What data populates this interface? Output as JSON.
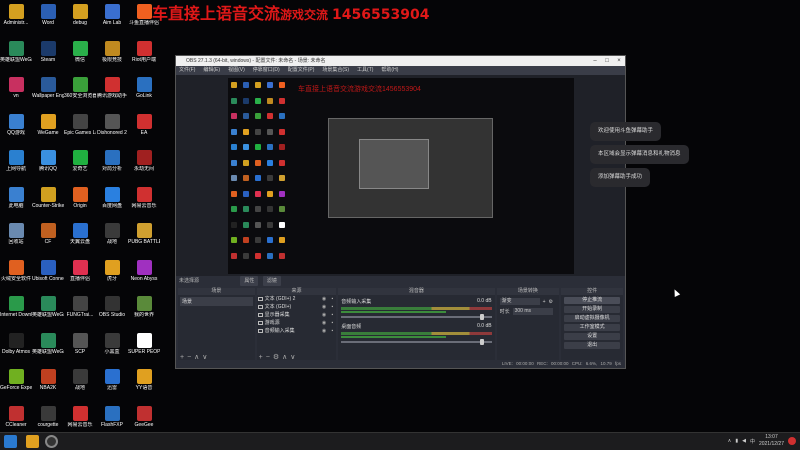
{
  "banner": {
    "text": "车直接上语音交流",
    "text2": "游戏交流",
    "qq": "1456553904",
    "color": "#e01818"
  },
  "desktop_icons": [
    {
      "label": "Administr...",
      "color": "#d4a020"
    },
    {
      "label": "Word",
      "color": "#2b5fb4"
    },
    {
      "label": "debug",
      "color": "#d4a020"
    },
    {
      "label": "Aim Lab",
      "color": "#3a6fd0"
    },
    {
      "label": "斗鱼直播伴侣",
      "color": "#f06020"
    },
    {
      "label": "英雄联盟WeGame版",
      "color": "#2a8a5a"
    },
    {
      "label": "Steam",
      "color": "#1b3a6a"
    },
    {
      "label": "微信",
      "color": "#2ab04a"
    },
    {
      "label": "极限竞技",
      "color": "#c08a20"
    },
    {
      "label": "Riot用户端",
      "color": "#d03030"
    },
    {
      "label": "vn",
      "color": "#c83060"
    },
    {
      "label": "Wallpaper Engine: ...",
      "color": "#2a5a9a"
    },
    {
      "label": "360安全浏览器",
      "color": "#3aa03a"
    },
    {
      "label": "腾讯游戏助手",
      "color": "#d03030"
    },
    {
      "label": "GoLink",
      "color": "#2a70c0"
    },
    {
      "label": "QQ游戏",
      "color": "#3a80d0"
    },
    {
      "label": "WeGame",
      "color": "#e0a020"
    },
    {
      "label": "Epic Games Launcher",
      "color": "#444444"
    },
    {
      "label": "Dishonored 2",
      "color": "#555555"
    },
    {
      "label": "EA",
      "color": "#d03030"
    },
    {
      "label": "上网导航",
      "color": "#2a80d0"
    },
    {
      "label": "腾讯QQ",
      "color": "#3a90e0"
    },
    {
      "label": "爱奇艺",
      "color": "#20b040"
    },
    {
      "label": "对局分析",
      "color": "#2a70c0"
    },
    {
      "label": "永劫无间",
      "color": "#a02020"
    },
    {
      "label": "此电脑",
      "color": "#3a80d0"
    },
    {
      "label": "Counter-Strike: Global Off...",
      "color": "#d0a020"
    },
    {
      "label": "Origin",
      "color": "#e06020"
    },
    {
      "label": "百度网盘",
      "color": "#2a80e0"
    },
    {
      "label": "网易云音乐",
      "color": "#d03030"
    },
    {
      "label": "回收站",
      "color": "#6a8ab0"
    },
    {
      "label": "CF",
      "color": "#c06020"
    },
    {
      "label": "天翼云盘",
      "color": "#2a70d0"
    },
    {
      "label": "战地",
      "color": "#3a3a3a"
    },
    {
      "label": "PUBG BATTLEGR...",
      "color": "#d0a030"
    },
    {
      "label": "火绒安全软件",
      "color": "#e06020"
    },
    {
      "label": "Ubisoft Connect",
      "color": "#2a60c0"
    },
    {
      "label": "直播伴侣",
      "color": "#e03050"
    },
    {
      "label": "虎牙",
      "color": "#e0a020"
    },
    {
      "label": "Neon Abyss",
      "color": "#a030c0"
    },
    {
      "label": "Internet Downlo...",
      "color": "#2a9a4a"
    },
    {
      "label": "英雄联盟WeGame版",
      "color": "#2a8a5a"
    },
    {
      "label": "FUNGTrai...",
      "color": "#444444"
    },
    {
      "label": "OBS Studio",
      "color": "#333333"
    },
    {
      "label": "我的世界",
      "color": "#5a8a3a"
    },
    {
      "label": "Dolby Atmos",
      "color": "#222222"
    },
    {
      "label": "英雄联盟WeGame版",
      "color": "#2a8a5a"
    },
    {
      "label": "SCP",
      "color": "#555555"
    },
    {
      "label": "小黑盒",
      "color": "#3a3a3a"
    },
    {
      "label": "SUPER PEOPLE CBT",
      "color": "#ffffff"
    },
    {
      "label": "GeForce Experience",
      "color": "#70b020"
    },
    {
      "label": "NBA2K",
      "color": "#c04020"
    },
    {
      "label": "战地",
      "color": "#3a3a3a"
    },
    {
      "label": "迅雷",
      "color": "#2a70d0"
    },
    {
      "label": "YY语音",
      "color": "#e0a020"
    },
    {
      "label": "CCleaner",
      "color": "#c03030"
    },
    {
      "label": "courgette",
      "color": "#3a3a3a"
    },
    {
      "label": "网易云音乐",
      "color": "#d03030"
    },
    {
      "label": "FlashFXP",
      "color": "#2a70c0"
    },
    {
      "label": "GeeGee",
      "color": "#c03030"
    }
  ],
  "obs": {
    "title": "OBS 27.1.3 (64-bit, windows) - 配置文件: 未命名 - 场景: 未命名",
    "menu": [
      "文件(F)",
      "编辑(E)",
      "视图(V)",
      "停靠窗口(D)",
      "配置文件(P)",
      "场景集合(S)",
      "工具(T)",
      "帮助(H)"
    ],
    "canvas_text": "车直接上语音交流游戏交流1456553904",
    "source_bar": {
      "label": "未选择源",
      "props": "属性",
      "filters": "滤镜"
    },
    "docks": {
      "scenes": {
        "title": "场景",
        "items": [
          "场景"
        ]
      },
      "sources": {
        "title": "来源",
        "items": [
          "文本 (GDI+) 2",
          "文本 (GDI+)",
          "显示器采集",
          "游戏源",
          "音频输入采集"
        ]
      },
      "mixer": {
        "title": "混音器",
        "channels": [
          {
            "name": "音频输入采集",
            "db": "0.0 dB"
          },
          {
            "name": "桌面音频",
            "db": "0.0 dB"
          }
        ]
      },
      "transitions": {
        "title": "场景转换",
        "type": "渐变",
        "duration_label": "时长",
        "duration": "300 ms"
      },
      "controls": {
        "title": "控件",
        "buttons": [
          "停止推流",
          "开始录制",
          "启动虚拟摄像机",
          "工作室模式",
          "设置",
          "退出"
        ]
      }
    },
    "status": "LIVE: 00:00:00    REC: 00:00:00    CPU: 6.6%, 10.79 fps"
  },
  "chat": [
    "欢迎使用斗鱼弹幕助手",
    "本区域会显示弹幕消息和礼物消息",
    "添加弹幕助手成功"
  ],
  "taskbar": {
    "lang": "中",
    "time": "13:07",
    "date": "2021/12/27"
  }
}
